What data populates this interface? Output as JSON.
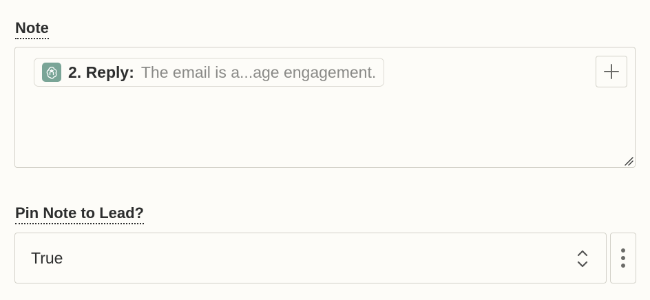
{
  "note_field": {
    "label": "Note",
    "pill": {
      "icon": "openai-icon",
      "step_label": "2. Reply:",
      "value_text": "The email is a...age engagement."
    },
    "insert_icon": "plus-icon"
  },
  "pin_field": {
    "label": "Pin Note to Lead?",
    "selected_value": "True",
    "chevron_icon": "chevron-up-down-icon",
    "more_icon": "vertical-ellipsis-icon"
  },
  "colors": {
    "background": "#fdfcf8",
    "border": "#d2d0c8",
    "text": "#2d2e2e",
    "muted_text": "#8a8a87",
    "icon_bg": "#7aa597"
  }
}
